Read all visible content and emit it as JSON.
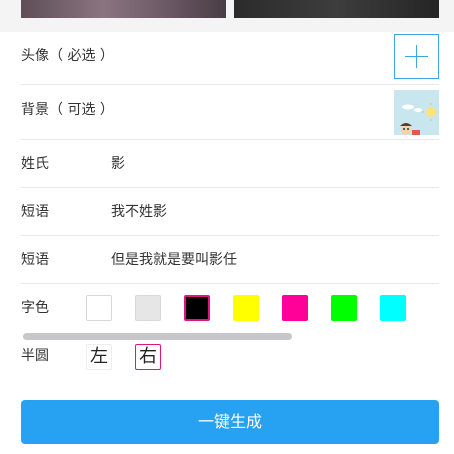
{
  "avatar": {
    "label": "头像（ 必选 ）"
  },
  "background": {
    "label": "背景（ 可选 ）"
  },
  "fields": [
    {
      "label": "姓氏",
      "value": "影"
    },
    {
      "label": "短语",
      "value": "我不姓影"
    },
    {
      "label": "短语",
      "value": "但是我就是要叫影任"
    }
  ],
  "font_color": {
    "label": "字色",
    "swatches": [
      "#ffffff",
      "#e6e6e6",
      "#000000",
      "#ffff00",
      "#ff0099",
      "#00ff00",
      "#00ffff"
    ],
    "selected_index": 2
  },
  "half_circle": {
    "label": "半圆",
    "options": [
      "左",
      "右"
    ],
    "selected_index": 1
  },
  "generate_button": {
    "label": "一键生成"
  }
}
